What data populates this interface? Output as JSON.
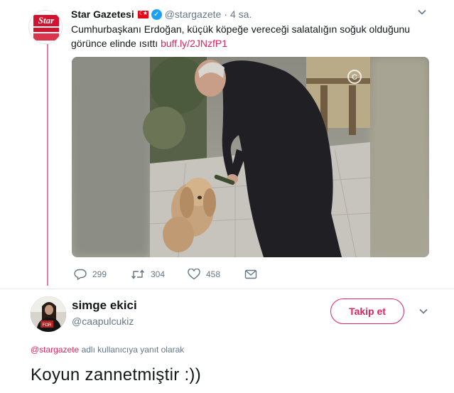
{
  "tweet": {
    "avatar": {
      "icon": "star-gazetesi-logo"
    },
    "name": "Star Gazetesi",
    "flag_icon": "turkish-flag-emoji",
    "verified_icon": "verified-badge",
    "handle": "@stargazete",
    "separator": "·",
    "time": "4 sa.",
    "text": "Cumhurbaşkanı Erdoğan, küçük köpeğe vereceği salatalığın soğuk olduğunu görünce elinde ısıttı",
    "link": "buff.ly/2JNzfP1",
    "media": {
      "watermark": "C"
    },
    "actions": {
      "replies": "299",
      "retweets": "304",
      "likes": "458"
    }
  },
  "reply": {
    "name": "simge ekici",
    "handle": "@caapulcukiz",
    "follow_label": "Takip et",
    "replying_mention": "@stargazete",
    "replying_suffix": "adlı kullanıcıya yanıt olarak",
    "text": "Koyun zannetmiştir :))"
  },
  "colors": {
    "accent": "#e0245e",
    "secondary_text": "#657786",
    "verified": "#1da1f2"
  }
}
